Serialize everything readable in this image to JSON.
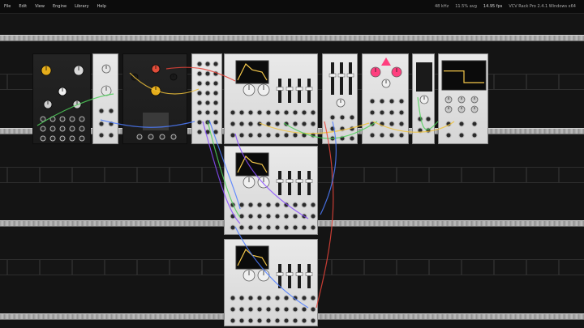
{
  "menubar": {
    "items": [
      "File",
      "Edit",
      "View",
      "Engine",
      "Library",
      "Help"
    ],
    "status": {
      "engine": "48 kHz",
      "cpu": "11.5% avg",
      "fps": "14.95 fps",
      "app": "VCV Rack Pro 2.4.1 Windows x64"
    }
  },
  "modules": [
    {
      "id": "m1",
      "title": "",
      "theme": "dark"
    },
    {
      "id": "m2",
      "title": "",
      "theme": "light"
    },
    {
      "id": "m3",
      "title": "",
      "theme": "dark"
    },
    {
      "id": "m4",
      "title": "",
      "theme": "light"
    },
    {
      "id": "m5",
      "title": "",
      "theme": "light"
    },
    {
      "id": "m6",
      "title": "",
      "theme": "light"
    },
    {
      "id": "m7",
      "title": "",
      "theme": "light"
    },
    {
      "id": "m8",
      "title": "",
      "theme": "light"
    },
    {
      "id": "m9",
      "title": "",
      "theme": "light"
    },
    {
      "id": "m10",
      "title": "",
      "theme": "light"
    },
    {
      "id": "m11",
      "title": "",
      "theme": "light"
    }
  ],
  "colors": {
    "accent": "#e5ad1b",
    "pink": "#ff3f7f",
    "cable_green": "#4fd15a",
    "cable_blue": "#4d7dff",
    "cable_red": "#e8443a",
    "cable_yellow": "#f0c23a",
    "cable_purple": "#8a4dff"
  }
}
